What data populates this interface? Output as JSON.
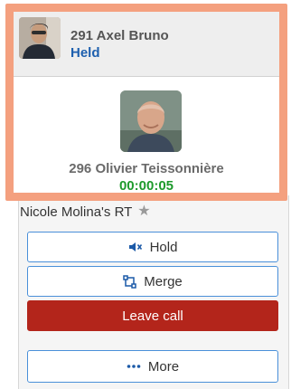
{
  "held_call": {
    "name": "291 Axel Bruno",
    "status": "Held",
    "avatar_icon": "person-photo-icon"
  },
  "active_call": {
    "name": "296 Olivier Teissonnière",
    "timer": "00:00:05",
    "avatar_icon": "person-photo-icon"
  },
  "room": {
    "title": "Nicole Molina's RT",
    "favorite_icon": "star-icon"
  },
  "actions": {
    "hold_label": "Hold",
    "merge_label": "Merge",
    "leave_label": "Leave call",
    "more_label": "More"
  },
  "colors": {
    "highlight": "#f4a07f",
    "held_status": "#1d5fae",
    "timer": "#1e9a2c",
    "leave_button": "#b3251b",
    "button_border": "#4a90d9"
  }
}
